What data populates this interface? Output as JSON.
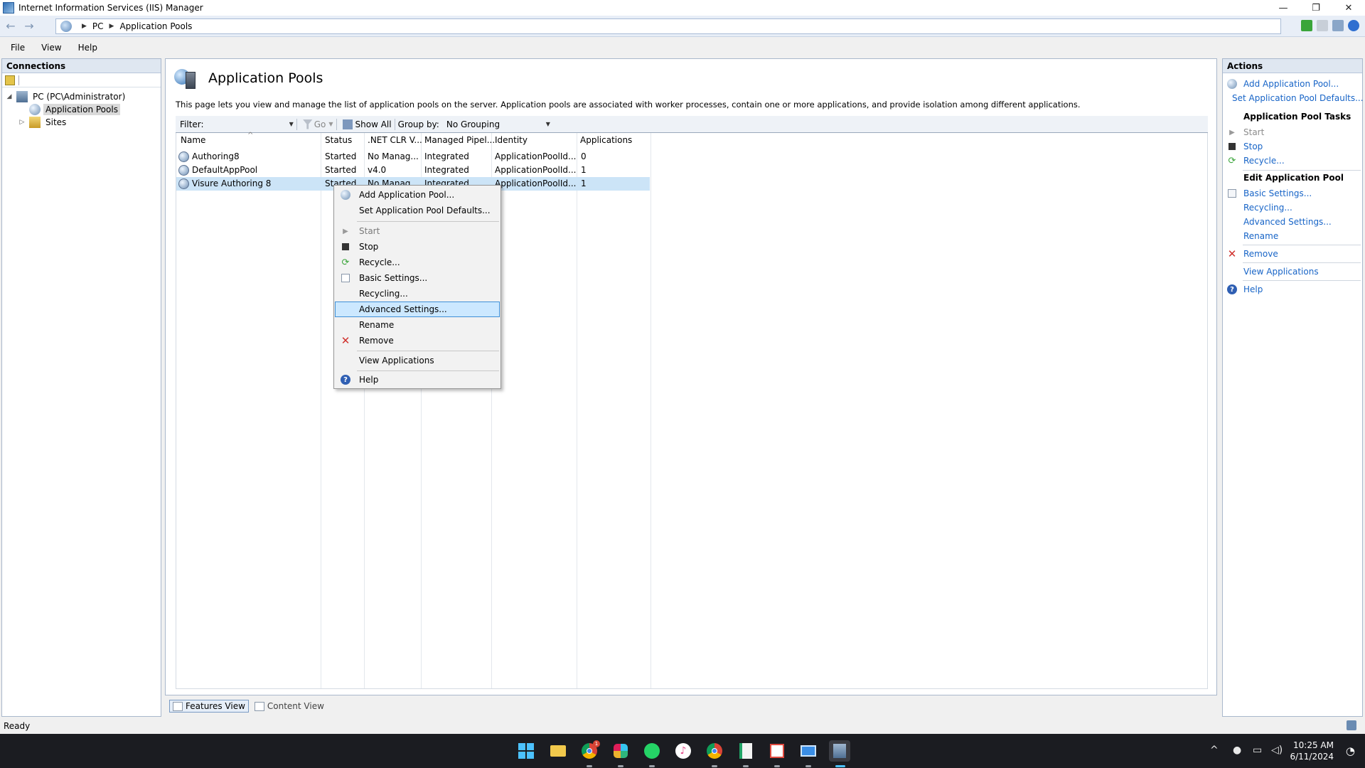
{
  "window": {
    "title": "Internet Information Services (IIS) Manager",
    "minimize": "—",
    "restore": "❐",
    "close": "✕"
  },
  "address": {
    "back": "←",
    "forward": "→",
    "crumbs": [
      "PC",
      "Application Pools"
    ],
    "separator": "▶"
  },
  "menu": {
    "items": [
      "File",
      "View",
      "Help"
    ]
  },
  "connections": {
    "header": "Connections",
    "tree": [
      {
        "label": "PC (PC\\Administrator)",
        "expander": "◢"
      },
      {
        "label": "Application Pools",
        "selected": true
      },
      {
        "label": "Sites",
        "expander": "▷"
      }
    ]
  },
  "main": {
    "title": "Application Pools",
    "description": "This page lets you view and manage the list of application pools on the server. Application pools are associated with worker processes, contain one or more applications, and provide isolation among different applications.",
    "filter": {
      "label": "Filter:",
      "value": "",
      "go_label": "Go",
      "show_all_label": "Show All",
      "group_by_label": "Group by:",
      "group_by_value": "No Grouping"
    },
    "columns": [
      "Name",
      "Status",
      ".NET CLR V...",
      "Managed Pipel...",
      "Identity",
      "Applications"
    ],
    "sort_glyph": "^",
    "rows": [
      {
        "name": "Authoring8",
        "status": "Started",
        "clr": "No Manag...",
        "pipeline": "Integrated",
        "identity": "ApplicationPoolId...",
        "apps": "0"
      },
      {
        "name": "DefaultAppPool",
        "status": "Started",
        "clr": "v4.0",
        "pipeline": "Integrated",
        "identity": "ApplicationPoolId...",
        "apps": "1"
      },
      {
        "name": "Visure Authoring 8",
        "status": "Started",
        "clr": "No Manag...",
        "pipeline": "Integrated",
        "identity": "ApplicationPoolId...",
        "apps": "1"
      }
    ],
    "view_tabs": [
      "Features View",
      "Content View"
    ]
  },
  "context_menu": {
    "items": [
      {
        "label": "Add Application Pool...",
        "icon": "add-pool-icon"
      },
      {
        "label": "Set Application Pool Defaults...",
        "icon": ""
      },
      {
        "label": "Start",
        "icon": "play-icon",
        "disabled": true
      },
      {
        "label": "Stop",
        "icon": "stop-icon"
      },
      {
        "label": "Recycle...",
        "icon": "recycle-icon"
      },
      {
        "label": "Basic Settings...",
        "icon": "settings-icon"
      },
      {
        "label": "Recycling...",
        "icon": ""
      },
      {
        "label": "Advanced Settings...",
        "icon": "",
        "highlight": true
      },
      {
        "label": "Rename",
        "icon": ""
      },
      {
        "label": "Remove",
        "icon": "remove-icon"
      },
      {
        "label": "View Applications",
        "icon": ""
      },
      {
        "label": "Help",
        "icon": "help-icon"
      }
    ]
  },
  "actions": {
    "header": "Actions",
    "add_pool": "Add Application Pool...",
    "set_defaults": "Set Application Pool Defaults...",
    "tasks_header": "Application Pool Tasks",
    "start": "Start",
    "stop": "Stop",
    "recycle": "Recycle...",
    "edit_header": "Edit Application Pool",
    "basic_settings": "Basic Settings...",
    "recycling": "Recycling...",
    "advanced_settings": "Advanced Settings...",
    "rename": "Rename",
    "remove": "Remove",
    "view_applications": "View Applications",
    "help": "Help"
  },
  "status": {
    "text": "Ready"
  },
  "taskbar": {
    "time": "10:25 AM",
    "date": "6/11/2024",
    "chrome_badge": "1"
  },
  "colors": {
    "link": "#1764c7",
    "selection": "#cce4f7",
    "menu_highlight": "#cce8ff",
    "remove_red": "#d0312d",
    "taskbar": "#1b1c21"
  }
}
